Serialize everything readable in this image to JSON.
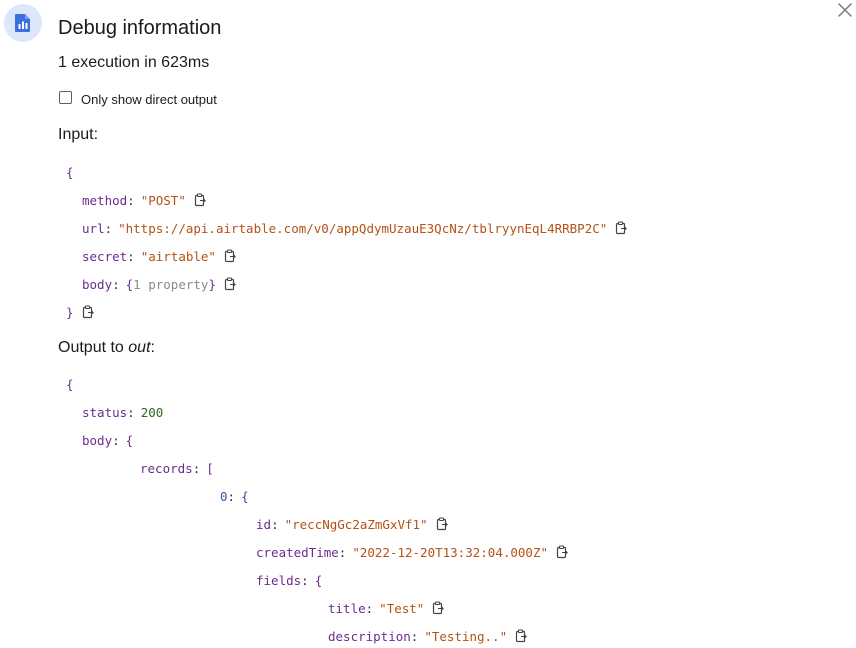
{
  "header": {
    "app_icon": "document-chart-icon",
    "title": "Debug information",
    "close_icon": "close-icon",
    "summary": "1 execution in 623ms"
  },
  "options": {
    "direct_output_label": "Only show direct output",
    "direct_output_checked": false
  },
  "input": {
    "heading": "Input:",
    "open_brace": "{",
    "close_brace": "}",
    "fields": [
      {
        "key": "method",
        "value": "\"POST\""
      },
      {
        "key": "url",
        "value": "\"https://api.airtable.com/v0/appQdymUzauE3QcNz/tblryynEqL4RRBP2C\""
      },
      {
        "key": "secret",
        "value": "\"airtable\""
      },
      {
        "key": "body",
        "value_prefix": "{",
        "value_meta": "1 property",
        "value_suffix": "}"
      }
    ]
  },
  "output": {
    "heading_prefix": "Output to ",
    "heading_var": "out",
    "heading_suffix": ":",
    "open_brace": "{",
    "status_key": "status",
    "status_value": "200",
    "body_key": "body",
    "body_open": "{",
    "records_key": "records",
    "records_open": "[",
    "item_index": "0",
    "item_open": "{",
    "id_key": "id",
    "id_value": "\"reccNgGc2aZmGxVf1\"",
    "created_key": "createdTime",
    "created_value": "\"2022-12-20T13:32:04.000Z\"",
    "fields_key": "fields",
    "fields_open": "{",
    "title_key": "title",
    "title_value": "\"Test\"",
    "description_key": "description",
    "description_value": "\"Testing..\""
  },
  "icons": {
    "copy": "copy-icon"
  }
}
